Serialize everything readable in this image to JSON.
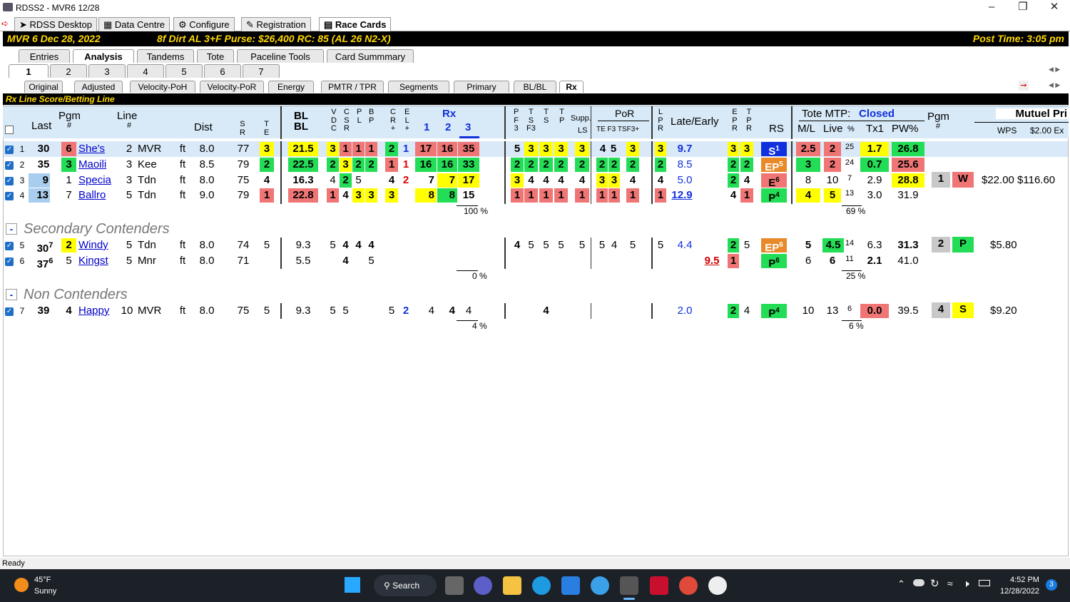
{
  "window": {
    "title": "RDSS2 - MVR6 12/28"
  },
  "app_tabs": [
    "RDSS Desktop",
    "Data Centre",
    "Configure",
    "Registration",
    "Race Cards"
  ],
  "race": {
    "info": "MVR  6   Dec 28, 2022",
    "conds": "8f  Dirt   AL  3+F   Purse: $26,400   RC: 85  (AL 26 N2-X)",
    "post": "Post Time: 3:05 pm"
  },
  "main_tabs": [
    "Entries",
    "Analysis",
    "Tandems",
    "Tote",
    "Paceline Tools",
    "Card Summmary"
  ],
  "race_tabs": [
    "1",
    "2",
    "3",
    "4",
    "5",
    "6",
    "7"
  ],
  "sub_tabs": [
    "Original",
    "Adjusted",
    "Velocity-PoH",
    "Velocity-PoR",
    "Energy",
    "PMTR / TPR",
    "Segments",
    "Primary",
    "BL/BL",
    "Rx"
  ],
  "section_title": "Rx Line Score/Betting Line",
  "headers": {
    "last": "Last",
    "pgm": "Pgm",
    "pgm_hash": "#",
    "line": "Line",
    "line_hash": "#",
    "dist": "Dist",
    "sr": "S\nR",
    "te": "T\nE",
    "blbl": "BL\nBL",
    "vdc": "V\nD\nC",
    "csr": "C\nS\nR",
    "pl": "P\nL",
    "bp": "B\nP",
    "cr": "C\nR\n+",
    "el": "E\nL\n+",
    "rx": "Rx",
    "rx1": "1",
    "rx2": "2",
    "rx3": "3",
    "pf3": "P\nF\n3",
    "tsf3": "T\nS\nF3",
    "ts": "T\nS",
    "tp": "T\nP",
    "supp": "Supp.",
    "ls": "LS",
    "por": "PoR",
    "por_sub": "TE F3  TSF3+",
    "lpr": "L\nP\nR",
    "late_early": "Late/Early",
    "epr": "E\nP\nR",
    "tpr": "T\nP\nR",
    "rs": "RS",
    "tote_mtp": "Tote MTP:",
    "closed": "Closed",
    "ml": "M/L",
    "live": "Live",
    "pct": "%",
    "tx1": "Tx1",
    "pw": "PW%",
    "pgm2": "Pgm",
    "pgm2_hash": "#",
    "mutuel": "Mutuel Pri",
    "wps": "WPS",
    "ex": "$2.00 Ex"
  },
  "contenders": [
    {
      "n": "1",
      "last": "30",
      "pgm": "6",
      "name": "She's",
      "line": "2",
      "trk": "MVR",
      "sf": "ft",
      "dist": "8.0",
      "sr": "77",
      "te": "3",
      "bl": "21.5",
      "v": "3",
      "c": "1",
      "p": "1",
      "b": "1",
      "cr": "2",
      "el": "1",
      "rx1": "17",
      "rx2": "16",
      "rx3": "35",
      "pf": "5",
      "tsf": "3",
      "ts": "3",
      "tp": "3",
      "ls": "3",
      "te2": "4",
      "f3": "5",
      "tsf3": "3",
      "lpr": "3",
      "le": "9.7",
      "epr": "3",
      "tpr": "3",
      "rs": "S",
      "rsn": "1",
      "ml": "2.5",
      "live": "2",
      "pc": "25",
      "tx": "1.7",
      "pw": "26.8",
      "p2": "",
      "wp": "",
      "pay": ""
    },
    {
      "n": "2",
      "last": "35",
      "pgm": "3",
      "name": "Maoili",
      "line": "3",
      "trk": "Kee",
      "sf": "ft",
      "dist": "8.5",
      "sr": "79",
      "te": "2",
      "bl": "22.5",
      "v": "2",
      "c": "3",
      "p": "2",
      "b": "2",
      "cr": "1",
      "el": "1",
      "rx1": "16",
      "rx2": "16",
      "rx3": "33",
      "pf": "2",
      "tsf": "2",
      "ts": "2",
      "tp": "2",
      "ls": "2",
      "te2": "2",
      "f3": "2",
      "tsf3": "2",
      "lpr": "2",
      "le": "8.5",
      "epr": "2",
      "tpr": "2",
      "rs": "EP",
      "rsn": "5",
      "ml": "3",
      "live": "2",
      "pc": "24",
      "tx": "0.7",
      "pw": "25.6",
      "p2": "",
      "wp": "",
      "pay": ""
    },
    {
      "n": "3",
      "last": "9",
      "pgm": "1",
      "name": "Specia",
      "line": "3",
      "trk": "Tdn",
      "sf": "ft",
      "dist": "8.0",
      "sr": "75",
      "te": "4",
      "bl": "16.3",
      "v": "4",
      "c": "2",
      "p": "5",
      "b": "",
      "cr": "4",
      "el": "2",
      "rx1": "7",
      "rx2": "7",
      "rx3": "17",
      "pf": "3",
      "tsf": "4",
      "ts": "4",
      "tp": "4",
      "ls": "4",
      "te2": "3",
      "f3": "3",
      "tsf3": "4",
      "lpr": "4",
      "le": "5.0",
      "epr": "2",
      "tpr": "4",
      "rs": "E",
      "rsn": "6",
      "ml": "8",
      "live": "10",
      "pc": "7",
      "tx": "2.9",
      "pw": "28.8",
      "p2": "1",
      "wp": "W",
      "pay": "$22.00 $116.60"
    },
    {
      "n": "4",
      "last": "13",
      "pgm": "7",
      "name": "Ballro",
      "line": "5",
      "trk": "Tdn",
      "sf": "ft",
      "dist": "9.0",
      "sr": "79",
      "te": "1",
      "bl": "22.8",
      "v": "1",
      "c": "4",
      "p": "3",
      "b": "3",
      "cr": "3",
      "el": "",
      "rx1": "8",
      "rx2": "8",
      "rx3": "15",
      "pf": "1",
      "tsf": "1",
      "ts": "1",
      "tp": "1",
      "ls": "1",
      "te2": "1",
      "f3": "1",
      "tsf3": "1",
      "lpr": "1",
      "le": "12.9",
      "epr": "4",
      "tpr": "1",
      "rs": "P",
      "rsn": "4",
      "ml": "4",
      "live": "5",
      "pc": "13",
      "tx": "3.0",
      "pw": "31.9",
      "p2": "",
      "wp": "",
      "pay": ""
    }
  ],
  "pct1": "100 %",
  "pct1b": "69 %",
  "secondary_title": "Secondary Contenders",
  "secondary": [
    {
      "n": "5",
      "last": "30",
      "sup": "7",
      "pgm": "2",
      "name": "Windy",
      "line": "5",
      "trk": "Tdn",
      "sf": "ft",
      "dist": "8.0",
      "sr": "74",
      "te": "5",
      "bl": "9.3",
      "v": "5",
      "c": "4",
      "p": "4",
      "b": "4",
      "pf": "4",
      "tsf": "5",
      "ts": "5",
      "tp": "5",
      "ls": "5",
      "te2": "5",
      "f3": "4",
      "tsf3": "5",
      "lpr": "5",
      "le": "4.4",
      "epr": "2",
      "tpr": "5",
      "rs": "EP",
      "rsn": "6",
      "ml": "5",
      "live": "4.5",
      "pc": "14",
      "tx": "6.3",
      "pw": "31.3",
      "p2": "2",
      "wp": "P",
      "pay": "$5.80"
    },
    {
      "n": "6",
      "last": "37",
      "sup": "6",
      "pgm": "5",
      "name": "Kingst",
      "line": "5",
      "trk": "Mnr",
      "sf": "ft",
      "dist": "8.0",
      "sr": "71",
      "bl": "5.5",
      "c": "4",
      "b": "5",
      "le": "9.5",
      "epr": "1",
      "rs": "P",
      "rsn": "6",
      "ml": "6",
      "live": "6",
      "pc": "11",
      "tx": "2.1",
      "pw": "41.0"
    }
  ],
  "pct2": "0 %",
  "pct2b": "25 %",
  "non_title": "Non Contenders",
  "non": [
    {
      "n": "7",
      "last": "39",
      "pgm": "4",
      "name": "Happy",
      "line": "10",
      "trk": "MVR",
      "sf": "ft",
      "dist": "8.0",
      "sr": "75",
      "te": "5",
      "bl": "9.3",
      "v": "5",
      "c": "5",
      "cr": "5",
      "el": "2",
      "rx1": "4",
      "rx2": "4",
      "rx3": "4",
      "ts": "4",
      "le": "2.0",
      "epr": "2",
      "tpr": "4",
      "rs": "P",
      "rsn": "4",
      "ml": "10",
      "live": "13",
      "pc": "6",
      "tx": "0.0",
      "pw": "39.5",
      "p2": "4",
      "wp": "S",
      "pay": "$9.20"
    }
  ],
  "pct3": "4 %",
  "pct3b": "6 %",
  "status": "Ready",
  "taskbar": {
    "temp": "45°F",
    "weather": "Sunny",
    "search": "Search",
    "time": "4:52 PM",
    "date": "12/28/2022",
    "badge": "3"
  }
}
